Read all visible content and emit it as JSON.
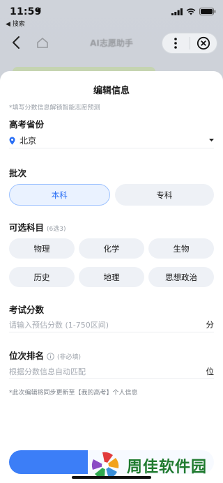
{
  "status_bar": {
    "time": "11:59",
    "back_label": "◀ 搜索"
  },
  "nav": {
    "title": "AI志愿助手"
  },
  "sheet": {
    "title": "编辑信息",
    "hint": "*填写分数信息解锁智能志愿预测",
    "province": {
      "label": "高考省份",
      "value": "北京"
    },
    "batch": {
      "label": "批次",
      "options": [
        "本科",
        "专科"
      ],
      "selected": "本科"
    },
    "subjects": {
      "label": "可选科目",
      "note": "(6选3)",
      "options": [
        "物理",
        "化学",
        "生物",
        "历史",
        "地理",
        "思想政治"
      ]
    },
    "score": {
      "label": "考试分数",
      "placeholder": "请输入预估分数 (1-750区间)",
      "unit": "分"
    },
    "rank": {
      "label": "位次排名",
      "note": "(非必填)",
      "placeholder": "根据分数信息自动匹配",
      "unit": "位"
    },
    "footer_note": "*此次编辑将同步更新至【我的高考】个人信息"
  },
  "watermark": {
    "text": "周佳软件园"
  },
  "colors": {
    "accent": "#2a6ff5",
    "chip_bg": "#eef1f6",
    "button": "#3c7ef7"
  }
}
